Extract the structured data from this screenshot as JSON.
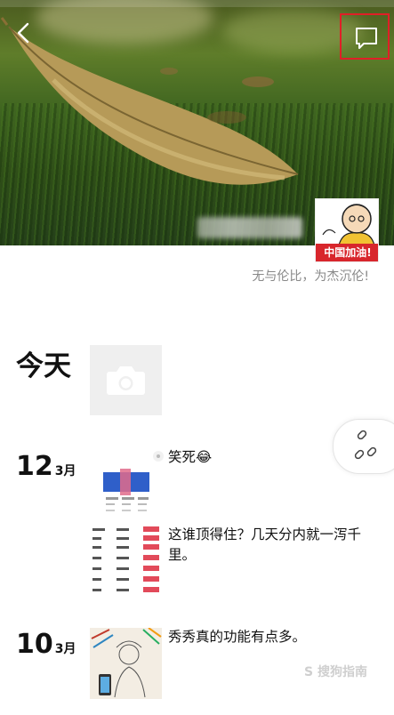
{
  "header": {
    "cover_alt": "fallen leaf on grass",
    "back_icon": "chevron-left-icon",
    "message_icon": "message-icon",
    "highlight_color": "#e01f27"
  },
  "profile": {
    "avatar_badge": "中国加油!",
    "signature": "无与伦比，为杰沉伦!"
  },
  "timeline": {
    "today_label": "今天",
    "posts": [
      {
        "day": "12",
        "month": "3月",
        "text": "笑死😂"
      },
      {
        "day": "",
        "month": "",
        "text": "这谁顶得住？几天分内就一泻千里。"
      },
      {
        "day": "10",
        "month": "3月",
        "text": "秀秀真的功能有点多。"
      }
    ]
  },
  "floating": {
    "link_icon": "link-icon"
  },
  "watermark": "S 搜狗指南"
}
